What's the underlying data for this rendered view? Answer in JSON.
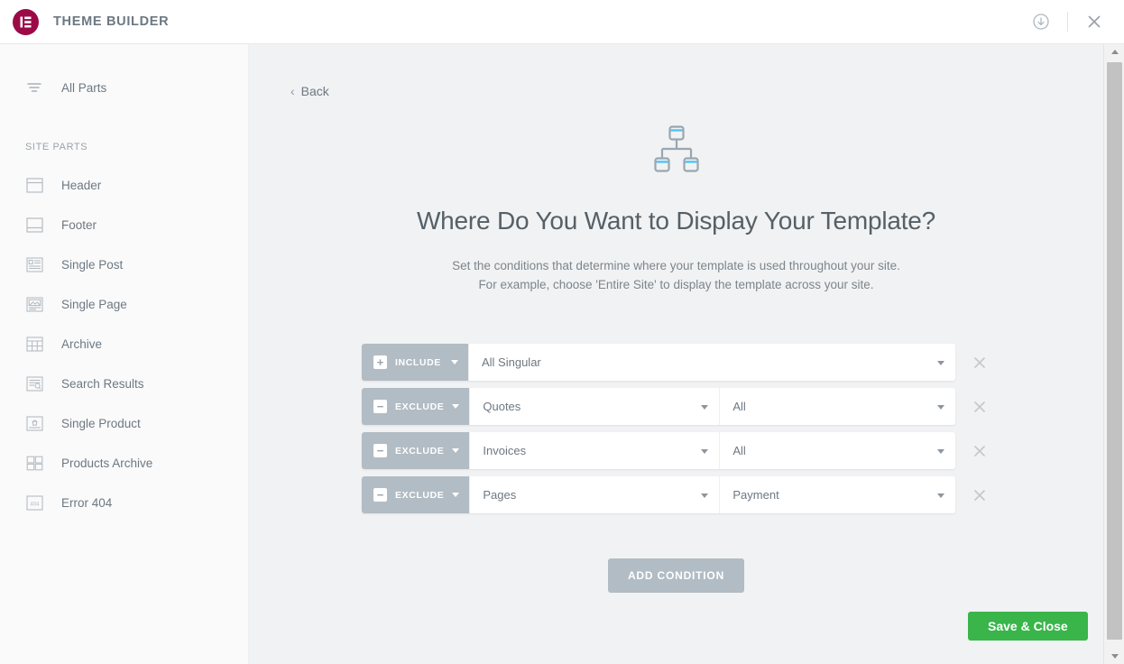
{
  "topbar": {
    "logo_icon": "elementor-logo-icon",
    "title": "THEME BUILDER",
    "import_icon": "download-circle-icon",
    "close_icon": "close-icon",
    "brand_color": "#9b0a46"
  },
  "sidebar": {
    "all_parts": {
      "label": "All Parts",
      "icon": "filter-lines-icon"
    },
    "section_label": "SITE PARTS",
    "items": [
      {
        "label": "Header",
        "icon": "header-layout-icon"
      },
      {
        "label": "Footer",
        "icon": "footer-layout-icon"
      },
      {
        "label": "Single Post",
        "icon": "single-post-icon"
      },
      {
        "label": "Single Page",
        "icon": "single-page-icon"
      },
      {
        "label": "Archive",
        "icon": "archive-grid-icon"
      },
      {
        "label": "Search Results",
        "icon": "search-results-icon"
      },
      {
        "label": "Single Product",
        "icon": "single-product-icon"
      },
      {
        "label": "Products Archive",
        "icon": "products-archive-icon"
      },
      {
        "label": "Error 404",
        "icon": "error-404-icon"
      }
    ]
  },
  "main": {
    "back_label": "Back",
    "back_icon": "chevron-left-icon",
    "hero_icon": "sitemap-icon",
    "hero_icon_accent": "#4fc3f7",
    "title": "Where Do You Want to Display Your Template?",
    "subtitle_line1": "Set the conditions that determine where your template is used throughout your site.",
    "subtitle_line2": "For example, choose 'Entire Site' to display the template across your site.",
    "conditions": [
      {
        "type": "INCLUDE",
        "type_glyph": "plus-icon",
        "selects": [
          {
            "value": "All Singular",
            "width": "wide"
          }
        ],
        "remove_icon": "close-icon"
      },
      {
        "type": "EXCLUDE",
        "type_glyph": "minus-icon",
        "selects": [
          {
            "value": "Quotes",
            "width": "half"
          },
          {
            "value": "All",
            "width": "half2"
          }
        ],
        "remove_icon": "close-icon"
      },
      {
        "type": "EXCLUDE",
        "type_glyph": "minus-icon",
        "selects": [
          {
            "value": "Invoices",
            "width": "half"
          },
          {
            "value": "All",
            "width": "half2"
          }
        ],
        "remove_icon": "close-icon"
      },
      {
        "type": "EXCLUDE",
        "type_glyph": "minus-icon",
        "selects": [
          {
            "value": "Pages",
            "width": "half"
          },
          {
            "value": "Payment",
            "width": "half2"
          }
        ],
        "remove_icon": "close-icon"
      }
    ],
    "add_condition_label": "ADD CONDITION",
    "save_label": "Save & Close",
    "save_color": "#39b54a",
    "condition_badge_color": "#b2bcc4"
  },
  "scrollbar": {
    "up_icon": "scroll-arrow-up-icon",
    "down_icon": "scroll-arrow-down-icon",
    "thumb": "scrollbar-thumb"
  }
}
